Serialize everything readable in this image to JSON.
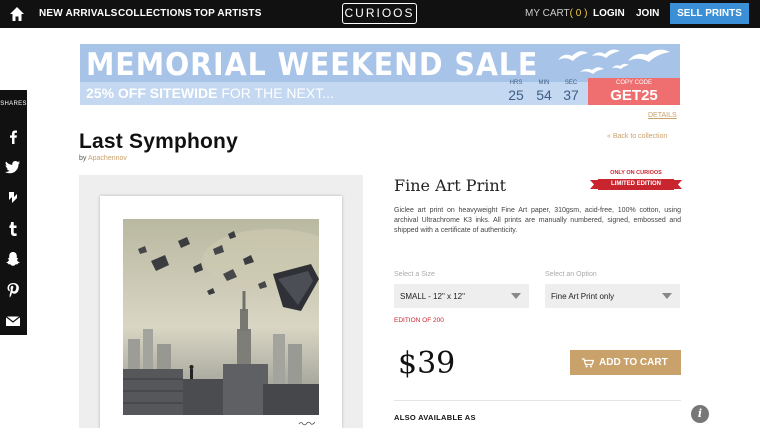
{
  "nav": {
    "items": [
      "NEW ARRIVALS",
      "COLLECTIONS",
      "TOP ARTISTS"
    ],
    "logo": "CURIOOS",
    "cart_label": "MY CART",
    "cart_count": "( 0 )",
    "login": "LOGIN",
    "join": "JOIN",
    "sell": "SELL PRINTS"
  },
  "share": {
    "label": "SHARES",
    "icons": [
      "facebook-icon",
      "twitter-icon",
      "stumbleupon-icon",
      "tumblr-icon",
      "snapchat-icon",
      "pinterest-icon",
      "email-icon"
    ]
  },
  "banner": {
    "headline": "MEMORIAL WEEKEND SALE",
    "offer_bold": "25% OFF SITEWIDE",
    "offer_rest": " FOR THE NEXT...",
    "countdown": [
      {
        "label": "HRS",
        "value": "25"
      },
      {
        "label": "MIN",
        "value": "54"
      },
      {
        "label": "SEC",
        "value": "37"
      }
    ],
    "code_label": "COPY CODE",
    "code": "GET25",
    "details": "DETAILS",
    "colors": {
      "background": "#a7c3e8",
      "band": "#c4d8f1",
      "code_bg": "#ef6f70"
    }
  },
  "product": {
    "title": "Last Symphony",
    "by": "by",
    "artist": "Apachennov",
    "back_link": "« Back to collection",
    "type": "Fine Art Print",
    "badge_top": "ONLY ON CURIOOS",
    "badge_bottom": "LIMITED EDITION",
    "description": "Giclee art print on heavyweight Fine Art paper, 310gsm, acid-free, 100% cotton, using archival Ultrachrome K3 inks. All prints are manually numbered, signed, embossed and shipped with a certificate of authenticity.",
    "size_label": "Select a Size",
    "size_value": "SMALL - 12\" x 12\"",
    "option_label": "Select an Option",
    "option_value": "Fine Art Print only",
    "edition": "EDITION OF 200",
    "price": "$39",
    "add_to_cart": "ADD TO CART",
    "also_available": "ALSO AVAILABLE AS"
  },
  "info_button": "i",
  "colors": {
    "accent": "#c9a16a",
    "sell_button": "#3a8fd6",
    "nav_bg": "#111111",
    "red": "#c9252f"
  }
}
